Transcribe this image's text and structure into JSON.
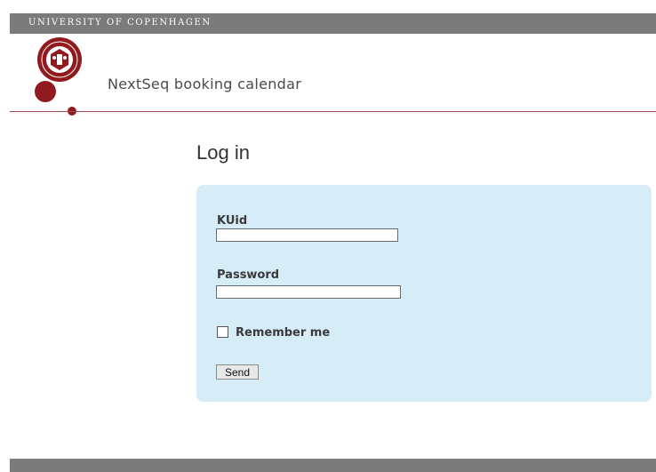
{
  "header": {
    "university": "UNIVERSITY OF COPENHAGEN",
    "app_title": "NextSeq booking calendar",
    "brand_color": "#901a1e",
    "logo_icon": "university-seal-icon"
  },
  "login": {
    "title": "Log in",
    "kuid_label": "KUid",
    "kuid_value": "",
    "password_label": "Password",
    "password_value": "",
    "remember_label": "Remember me",
    "remember_checked": false,
    "send_label": "Send",
    "panel_color": "#d6edf8"
  }
}
